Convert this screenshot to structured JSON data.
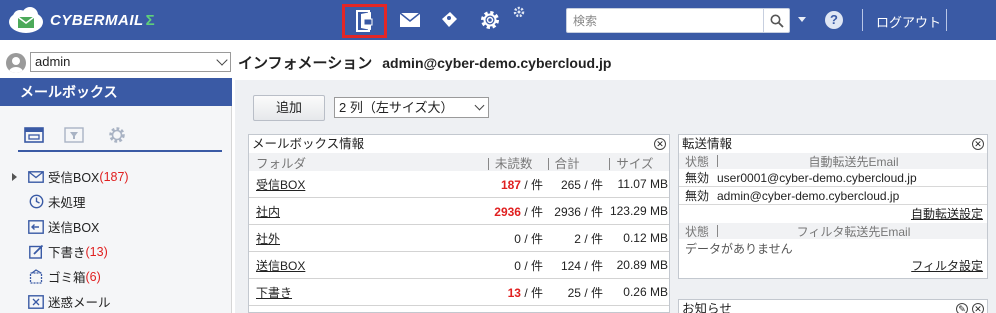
{
  "app": {
    "name": "CYBERMAIL",
    "sigma": "Σ"
  },
  "topbar": {
    "search_placeholder": "検索",
    "help_label": "?",
    "logout_label": "ログアウト",
    "accent": "#3a5aa5",
    "highlight": "#e32626"
  },
  "sidebar": {
    "user": "admin",
    "mailbox_header": "メールボックス",
    "folders": [
      {
        "name": "受信BOX",
        "count": "(187)",
        "icon": "inbox-icon"
      },
      {
        "name": "未処理",
        "count": "",
        "icon": "clock-icon"
      },
      {
        "name": "送信BOX",
        "count": "",
        "icon": "outbox-icon"
      },
      {
        "name": "下書き",
        "count": "(13)",
        "icon": "draft-icon"
      },
      {
        "name": "ゴミ箱",
        "count": "(6)",
        "icon": "trash-icon"
      },
      {
        "name": "迷惑メール",
        "count": "",
        "icon": "spam-icon"
      }
    ]
  },
  "main": {
    "title": "インフォメーション",
    "address": "admin@cyber-demo.cybercloud.jp",
    "add_button": "追加",
    "layout_select": "2 列（左サイズ大）",
    "mailbox_panel": {
      "title": "メールボックス情報",
      "headers": {
        "folder": "フォルダ",
        "unread": "未読数",
        "total": "合計",
        "size": "サイズ"
      },
      "unit": "/ 件",
      "rows": [
        {
          "folder": "受信BOX",
          "unread": "187",
          "total": "265",
          "size": "11.07 MB"
        },
        {
          "folder": "社内",
          "unread": "2936",
          "total": "2936",
          "size": "123.29 MB"
        },
        {
          "folder": "社外",
          "unread": "0",
          "total": "2",
          "size": "0.12 MB"
        },
        {
          "folder": "送信BOX",
          "unread": "0",
          "total": "124",
          "size": "20.89 MB"
        },
        {
          "folder": "下書き",
          "unread": "13",
          "total": "25",
          "size": "0.26 MB"
        }
      ]
    },
    "forward_panel": {
      "title": "転送情報",
      "status_header": "状態",
      "auto_header": "自動転送先Email",
      "auto_rows": [
        {
          "status": "無効",
          "email": "user0001@cyber-demo.cybercloud.jp"
        },
        {
          "status": "無効",
          "email": "admin@cyber-demo.cybercloud.jp"
        }
      ],
      "auto_link": "自動転送設定",
      "filter_header": "フィルタ転送先Email",
      "filter_empty": "データがありません",
      "filter_link": "フィルタ設定"
    },
    "notice_panel": {
      "title": "お知らせ"
    }
  }
}
